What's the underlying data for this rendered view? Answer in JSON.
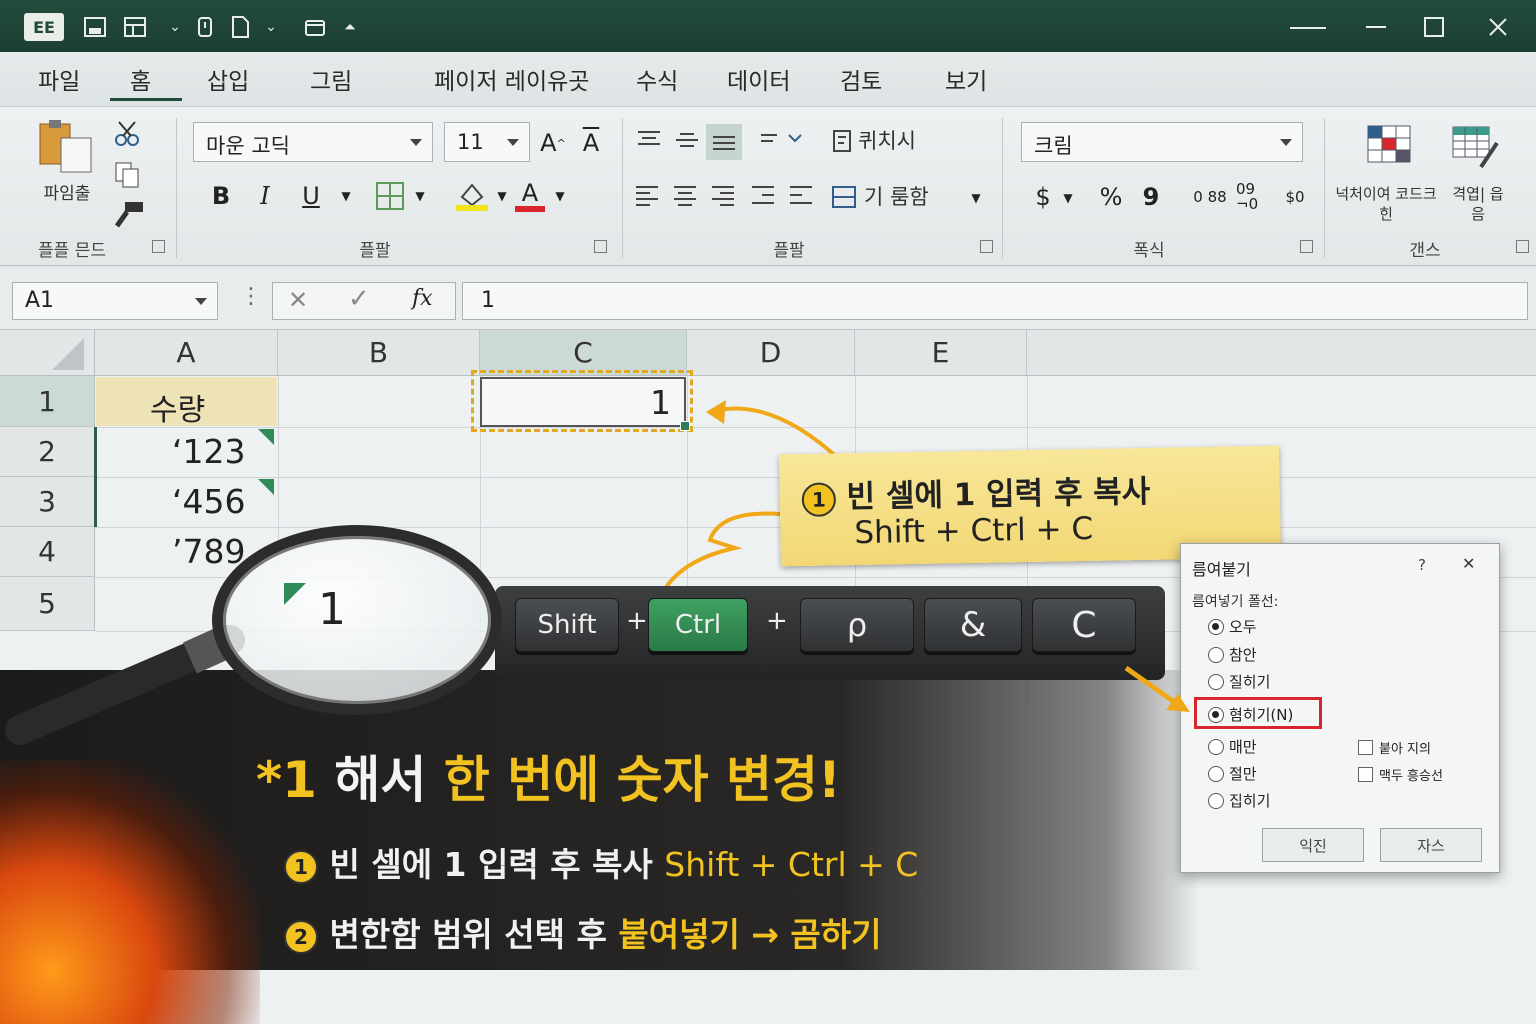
{
  "app_icon": "EE",
  "tabs": [
    "파일",
    "홈",
    "삽입",
    "그림",
    "페이저 레이유곳",
    "수식",
    "데이터",
    "검토",
    "보기"
  ],
  "ribbon": {
    "clipboard": {
      "paste_label": "파임출",
      "group_label": "플플 믄드"
    },
    "font": {
      "family": "마운 고딕",
      "size": "11",
      "grow": "A",
      "shrink": "A",
      "bold": "B",
      "italic": "I",
      "underline": "U",
      "font_color_letter": "A",
      "group_label": "플팔"
    },
    "align": {
      "wrap_label": "퀴치시",
      "merge_label": "기 룸함",
      "group_label": "플팔"
    },
    "number": {
      "format": "크림",
      "currency": "$",
      "percent": "%",
      "comma": "9",
      "inc_decimal": "0 88",
      "dec_decimal": "09 ¬0",
      "group_label": "폭식"
    },
    "styles": {
      "cond_format": "넉처이여 코드크힌",
      "table_format": "격엽| 읍음",
      "group_label": "갠스"
    }
  },
  "formula_bar": {
    "name_box": "A1",
    "cancel": "✕",
    "enter": "✓",
    "fx": "fx",
    "value": "1"
  },
  "columns": [
    "A",
    "B",
    "C",
    "D",
    "E"
  ],
  "rows": [
    "1",
    "2",
    "3",
    "4",
    "5"
  ],
  "cells": {
    "A1": "수량",
    "A2": "‘123",
    "A3": "‘456",
    "A4": "’789",
    "C1": "1",
    "B5": "1"
  },
  "callout": {
    "num": "1",
    "line1": "빈 셀에 1 입력 후 복사",
    "line2": "Shift + Ctrl + C"
  },
  "keys": {
    "shift": "Shift",
    "ctrl": "Ctrl",
    "p": "ρ",
    "amp": "&",
    "c": "C",
    "plus": "+"
  },
  "dialog": {
    "title": "름여붙기",
    "help": "?",
    "close": "✕",
    "section": "름여넣기 폴선:",
    "options": [
      "오두",
      "참안",
      "질히기",
      "혐히기(N)",
      "매만",
      "절만",
      "집히기"
    ],
    "checks": [
      "붙아 지의",
      "맥두 흥승선"
    ],
    "ok": "익진",
    "cancel": "자스"
  },
  "headline": {
    "star": "*1",
    "part1": "해서",
    "part2": "한 번에 숫자 변경!"
  },
  "steps": [
    {
      "num": "1",
      "text": "빈 셀에 1 입력 후 복사",
      "accent": "Shift + Ctrl + C"
    },
    {
      "num": "2",
      "text": "변한함 범위 선택 후",
      "accent": "붙여넣기 → 곰하기"
    }
  ],
  "colors": {
    "title_bar": "#234b3c",
    "accent_yellow": "#f2c220",
    "excel_green": "#2e8b57",
    "highlight_red": "#d9262c"
  }
}
